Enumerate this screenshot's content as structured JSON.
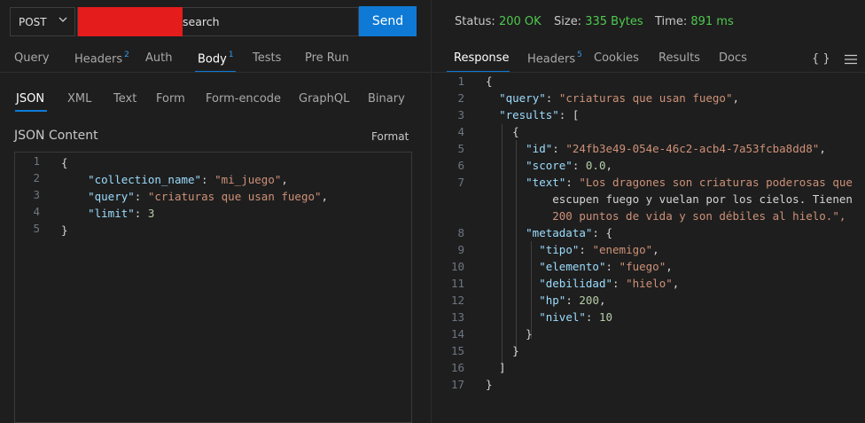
{
  "request": {
    "method": "POST",
    "url_suffix": "search",
    "send_label": "Send",
    "tabs": [
      {
        "label": "Query",
        "badge": ""
      },
      {
        "label": "Headers",
        "badge": "2"
      },
      {
        "label": "Auth",
        "badge": ""
      },
      {
        "label": "Body",
        "badge": "1"
      },
      {
        "label": "Tests",
        "badge": ""
      },
      {
        "label": "Pre Run",
        "badge": ""
      }
    ],
    "body_tabs": [
      "JSON",
      "XML",
      "Text",
      "Form",
      "Form-encode",
      "GraphQL",
      "Binary"
    ],
    "content_label": "JSON Content",
    "format_label": "Format",
    "editor_lines": [
      "{",
      "    \"collection_name\": \"mi_juego\",",
      "    \"query\": \"criaturas que usan fuego\",",
      "    \"limit\": 3",
      "}"
    ]
  },
  "response": {
    "status_label": "Status:",
    "status_value": "200 OK",
    "size_label": "Size:",
    "size_value": "335 Bytes",
    "time_label": "Time:",
    "time_value": "891 ms",
    "tabs": [
      {
        "label": "Response",
        "badge": ""
      },
      {
        "label": "Headers",
        "badge": "5"
      },
      {
        "label": "Cookies",
        "badge": ""
      },
      {
        "label": "Results",
        "badge": ""
      },
      {
        "label": "Docs",
        "badge": ""
      }
    ],
    "braces_icon": "{ }",
    "menu_icon": "menu-icon",
    "lines": [
      {
        "n": "1",
        "text": "{"
      },
      {
        "n": "2",
        "text": "  \"query\": \"criaturas que usan fuego\","
      },
      {
        "n": "3",
        "text": "  \"results\": ["
      },
      {
        "n": "4",
        "text": "    {"
      },
      {
        "n": "5",
        "text": "      \"id\": \"24fb3e49-054e-46c2-acb4-7a53fcba8dd8\","
      },
      {
        "n": "6",
        "text": "      \"score\": 0.0,"
      },
      {
        "n": "7",
        "text": "      \"text\": \"Los dragones son criaturas poderosas que"
      },
      {
        "n": "",
        "text": "          escupen fuego y vuelan por los cielos. Tienen"
      },
      {
        "n": "",
        "text": "          200 puntos de vida y son débiles al hielo.\","
      },
      {
        "n": "8",
        "text": "      \"metadata\": {"
      },
      {
        "n": "9",
        "text": "        \"tipo\": \"enemigo\","
      },
      {
        "n": "10",
        "text": "        \"elemento\": \"fuego\","
      },
      {
        "n": "11",
        "text": "        \"debilidad\": \"hielo\","
      },
      {
        "n": "12",
        "text": "        \"hp\": 200,"
      },
      {
        "n": "13",
        "text": "        \"nivel\": 10"
      },
      {
        "n": "14",
        "text": "      }"
      },
      {
        "n": "15",
        "text": "    }"
      },
      {
        "n": "16",
        "text": "  ]"
      },
      {
        "n": "17",
        "text": "}"
      }
    ]
  },
  "colors": {
    "accent": "#0e7ad6",
    "status_ok": "#4ec94e",
    "json_key": "#9cdcfe",
    "json_string": "#ce9178",
    "json_number": "#b5cea8"
  }
}
